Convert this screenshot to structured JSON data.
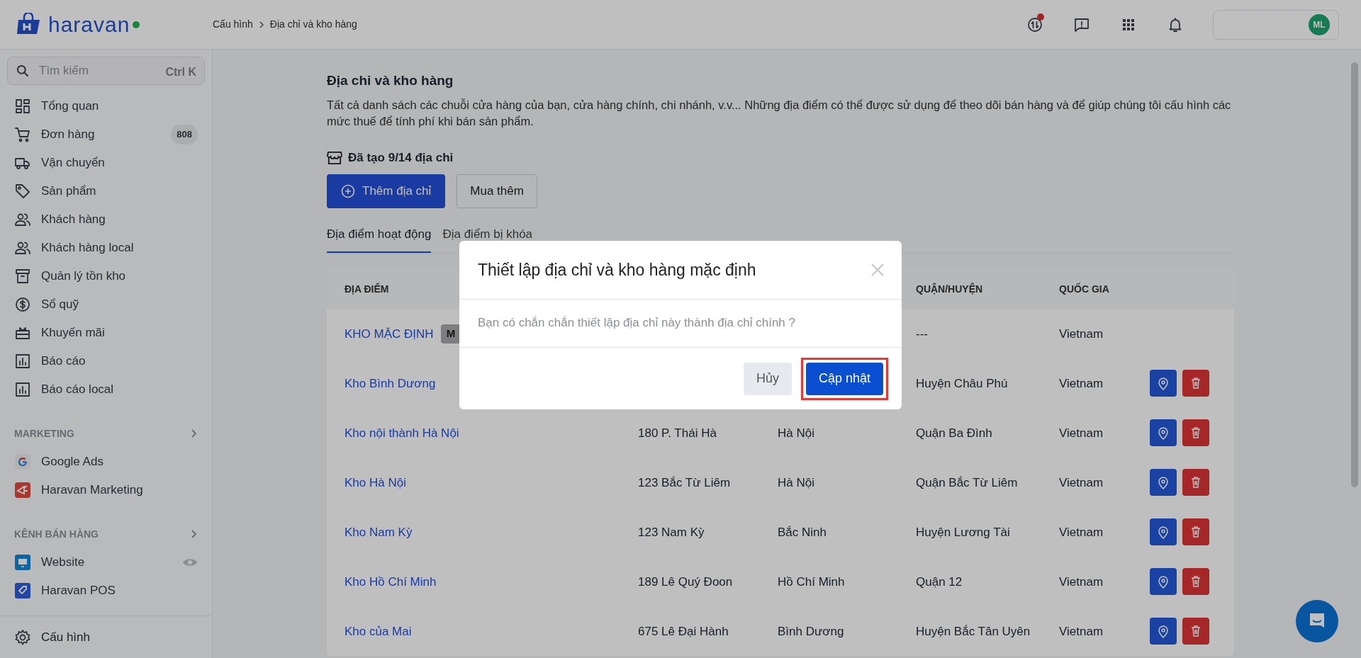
{
  "logo": {
    "text": "haravan"
  },
  "breadcrumb": [
    "Cấu hình",
    "Địa chỉ và kho hàng"
  ],
  "topbar_icons": [
    {
      "kind": "sync",
      "dot": true
    },
    {
      "kind": "feedback",
      "dot": false
    },
    {
      "kind": "apps",
      "dot": false
    },
    {
      "kind": "bell",
      "dot": false
    }
  ],
  "account": {
    "initials": "ML"
  },
  "sidebar": {
    "search": {
      "placeholder": "Tìm kiếm",
      "shortcut": "Ctrl K"
    },
    "items": [
      {
        "label": "Tổng quan",
        "kind": "dashboard"
      },
      {
        "label": "Đơn hàng",
        "kind": "cart",
        "count": "808"
      },
      {
        "label": "Vận chuyển",
        "kind": "truck"
      },
      {
        "label": "Sản phẩm",
        "kind": "tag"
      },
      {
        "label": "Khách hàng",
        "kind": "people"
      },
      {
        "label": "Khách hàng local",
        "kind": "people"
      },
      {
        "label": "Quản lý tồn kho",
        "kind": "archive"
      },
      {
        "label": "Sổ quỹ",
        "kind": "dollar"
      },
      {
        "label": "Khuyến mãi",
        "kind": "gift"
      },
      {
        "label": "Báo cáo",
        "kind": "chart"
      },
      {
        "label": "Báo cáo local",
        "kind": "chart"
      }
    ],
    "sections": [
      {
        "title": "MARKETING",
        "items": [
          {
            "label": "Google Ads",
            "kind": "google"
          },
          {
            "label": "Haravan Marketing",
            "kind": "marketing"
          }
        ]
      },
      {
        "title": "KÊNH BÁN HÀNG",
        "items": [
          {
            "label": "Website",
            "kind": "website",
            "visible": true
          },
          {
            "label": "Haravan POS",
            "kind": "pos"
          }
        ]
      }
    ],
    "footer": {
      "label": "Cấu hình"
    }
  },
  "page": {
    "title": "Địa chỉ và kho hàng",
    "description": "Tất cả danh sách các chuỗi cửa hàng của bạn, cửa hàng chính, chi nhánh, v.v... Những địa điểm có thể được sử dụng để theo dõi bán hàng và để giúp chúng tôi cấu hình các mức thuế để tính phí khi bán sản phẩm.",
    "quota": "Đã tạo 9/14 địa chỉ",
    "buttons": [
      {
        "label": "Thêm địa chỉ",
        "kind": "primary"
      },
      {
        "label": "Mua thêm",
        "kind": "secondary"
      }
    ],
    "tabs": [
      {
        "label": "Địa điểm hoạt động",
        "selected": true
      },
      {
        "label": "Địa điểm bị khóa",
        "selected": false
      }
    ],
    "table": {
      "columns": {
        "location": "ĐỊA ĐIỂM",
        "district": "QUẬN/HUYỆN",
        "country": "QUỐC GIA"
      },
      "rows": [
        {
          "name": "KHO MẶC ĐỊNH",
          "badge": "M",
          "district": "---",
          "country": "Vietnam",
          "actions": false
        },
        {
          "name": "Kho Bình Dương",
          "district": "Huyện Châu Phú",
          "country": "Vietnam",
          "actions": true
        },
        {
          "name": "Kho nội thành Hà Nội",
          "address": "180 P. Thái Hà",
          "city": "Hà Nội",
          "district": "Quận Ba Đình",
          "country": "Vietnam",
          "actions": true
        },
        {
          "name": "Kho Hà Nội",
          "address": "123 Bắc Từ Liêm",
          "city": "Hà Nội",
          "district": "Quận Bắc Từ Liêm",
          "country": "Vietnam",
          "actions": true
        },
        {
          "name": "Kho Nam Kỳ",
          "address": "123 Nam Kỳ",
          "city": "Bắc Ninh",
          "district": "Huyện Lương Tài",
          "country": "Vietnam",
          "actions": true
        },
        {
          "name": "Kho Hồ Chí Minh",
          "address": "189 Lê Quý Đoon",
          "city": "Hồ Chí Minh",
          "district": "Quận 12",
          "country": "Vietnam",
          "actions": true
        },
        {
          "name": "Kho của Mai",
          "address": "675 Lê Đại Hành",
          "city": "Bình Dương",
          "district": "Huyện Bắc Tân Uyên",
          "country": "Vietnam",
          "actions": true
        }
      ]
    }
  },
  "modal": {
    "title": "Thiết lập địa chỉ và kho hàng mặc định",
    "message": "Bạn có chắn chắn thiết lập địa chỉ này thành địa chỉ chính ?",
    "cancel": "Hủy",
    "confirm": "Cập nhật",
    "confirm_highlighted": true
  }
}
